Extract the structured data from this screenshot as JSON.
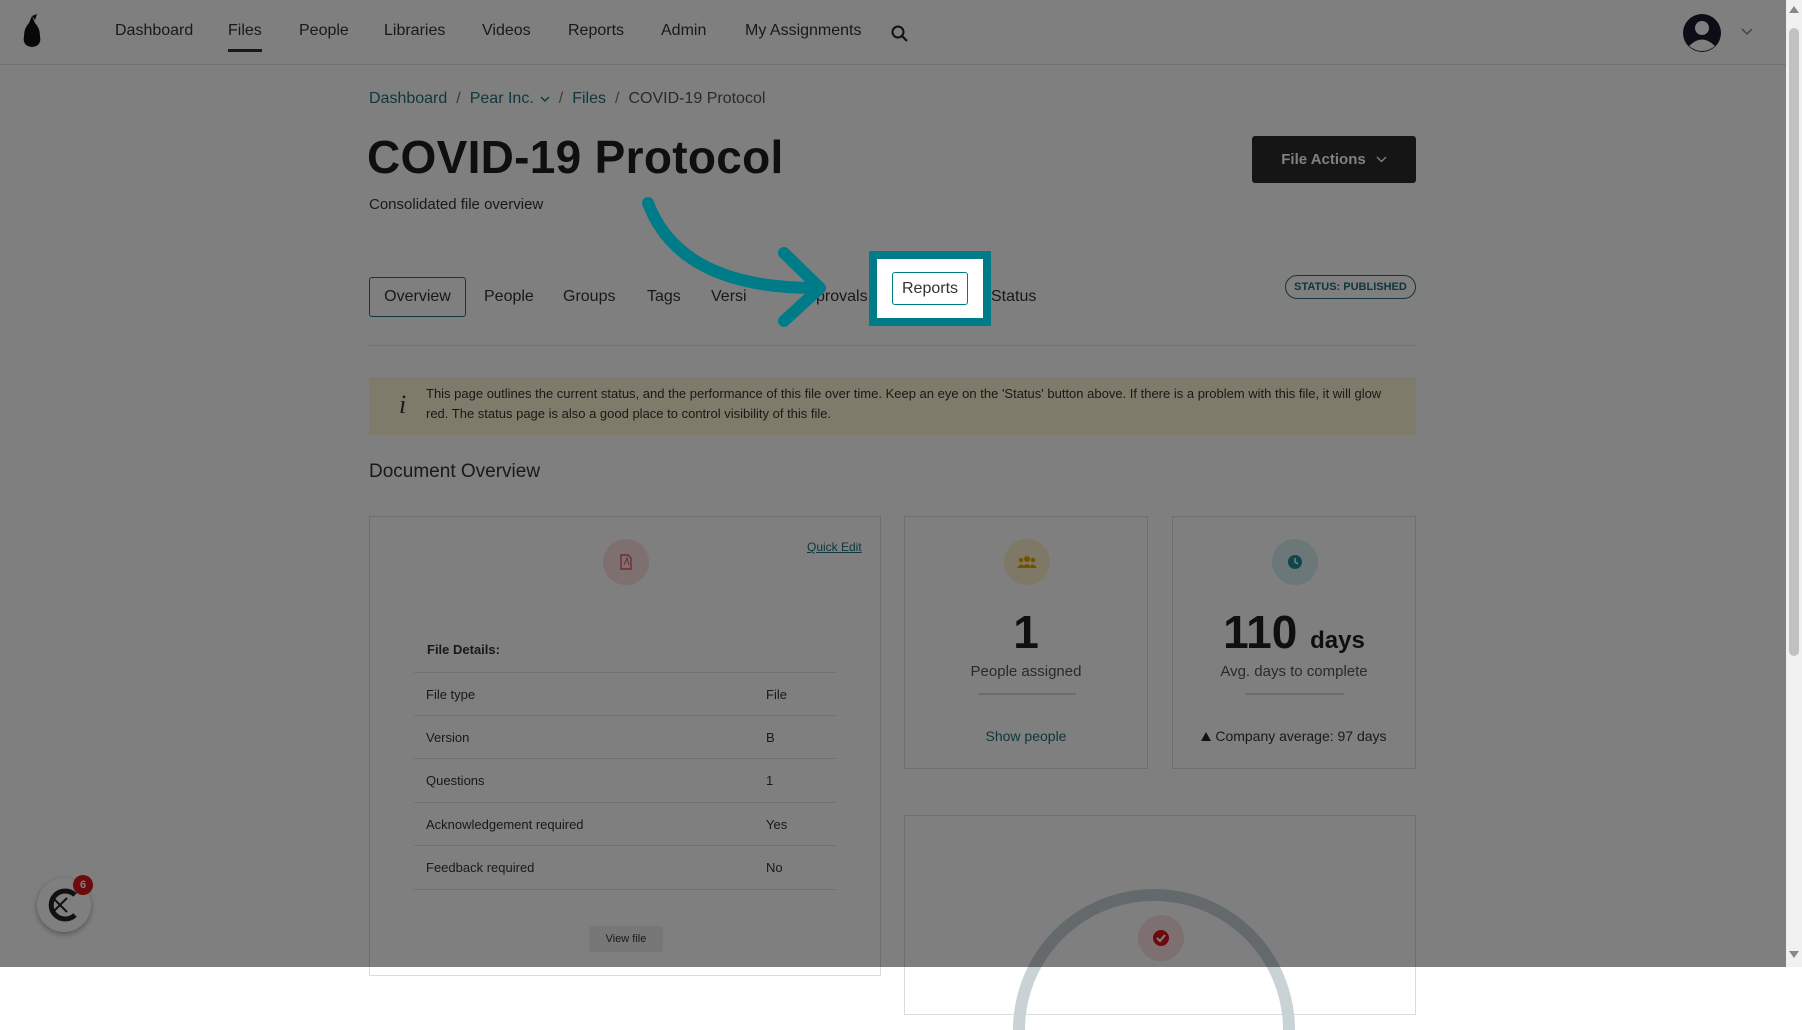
{
  "nav": {
    "items": [
      "Dashboard",
      "Files",
      "People",
      "Libraries",
      "Videos",
      "Reports",
      "Admin",
      "My Assignments"
    ],
    "active": "Files"
  },
  "breadcrumb": {
    "dashboard": "Dashboard",
    "org": "Pear Inc.",
    "files": "Files",
    "current": "COVID-19 Protocol",
    "separator": "/"
  },
  "header": {
    "title": "COVID-19 Protocol",
    "subtitle": "Consolidated file overview",
    "file_actions_label": "File Actions"
  },
  "tabs": {
    "overview": "Overview",
    "people": "People",
    "groups": "Groups",
    "tags": "Tags",
    "versions_partial": "Versi",
    "approvals_partial": "provals",
    "reports": "Reports",
    "status": "Status"
  },
  "status_badge": "STATUS: PUBLISHED",
  "info_banner": {
    "icon": "i",
    "text": "This page outlines the current status, and the performance of this file over time. Keep an eye on the 'Status' button above. If there is a problem with this file, it will glow red. The status page is also a good place to control visibility of this file."
  },
  "section_title": "Document Overview",
  "file_card": {
    "quick_edit": "Quick Edit",
    "details_title": "File Details:",
    "rows": [
      {
        "key": "File type",
        "value": "File"
      },
      {
        "key": "Version",
        "value": "B"
      },
      {
        "key": "Questions",
        "value": "1"
      },
      {
        "key": "Acknowledgement required",
        "value": "Yes"
      },
      {
        "key": "Feedback required",
        "value": "No"
      }
    ],
    "view_file": "View file"
  },
  "people_card": {
    "number": "1",
    "label": "People assigned",
    "link": "Show people"
  },
  "days_card": {
    "number": "110",
    "unit": "days",
    "label": "Avg. days to complete",
    "company_avg_label": "Company average:",
    "company_avg_value": "97 days"
  },
  "chat": {
    "badge_count": "6"
  },
  "colors": {
    "accent": "#007c89",
    "link": "#1f6f7a",
    "pdf_icon_bg": "#fde1e1",
    "people_icon_bg": "#fff1cc",
    "clock_icon_bg": "#d7eef1",
    "check_icon_bg": "#fde1e1",
    "banner_bg": "#fff6d6",
    "badge_red": "#d9141b"
  },
  "icons": [
    "pear-logo-icon",
    "search-icon",
    "user-avatar-icon",
    "chevron-down-icon",
    "pdf-file-icon",
    "people-group-icon",
    "clock-icon",
    "check-circle-icon",
    "info-icon",
    "caret-up-icon",
    "chat-widget-icon",
    "curved-arrow-icon"
  ]
}
